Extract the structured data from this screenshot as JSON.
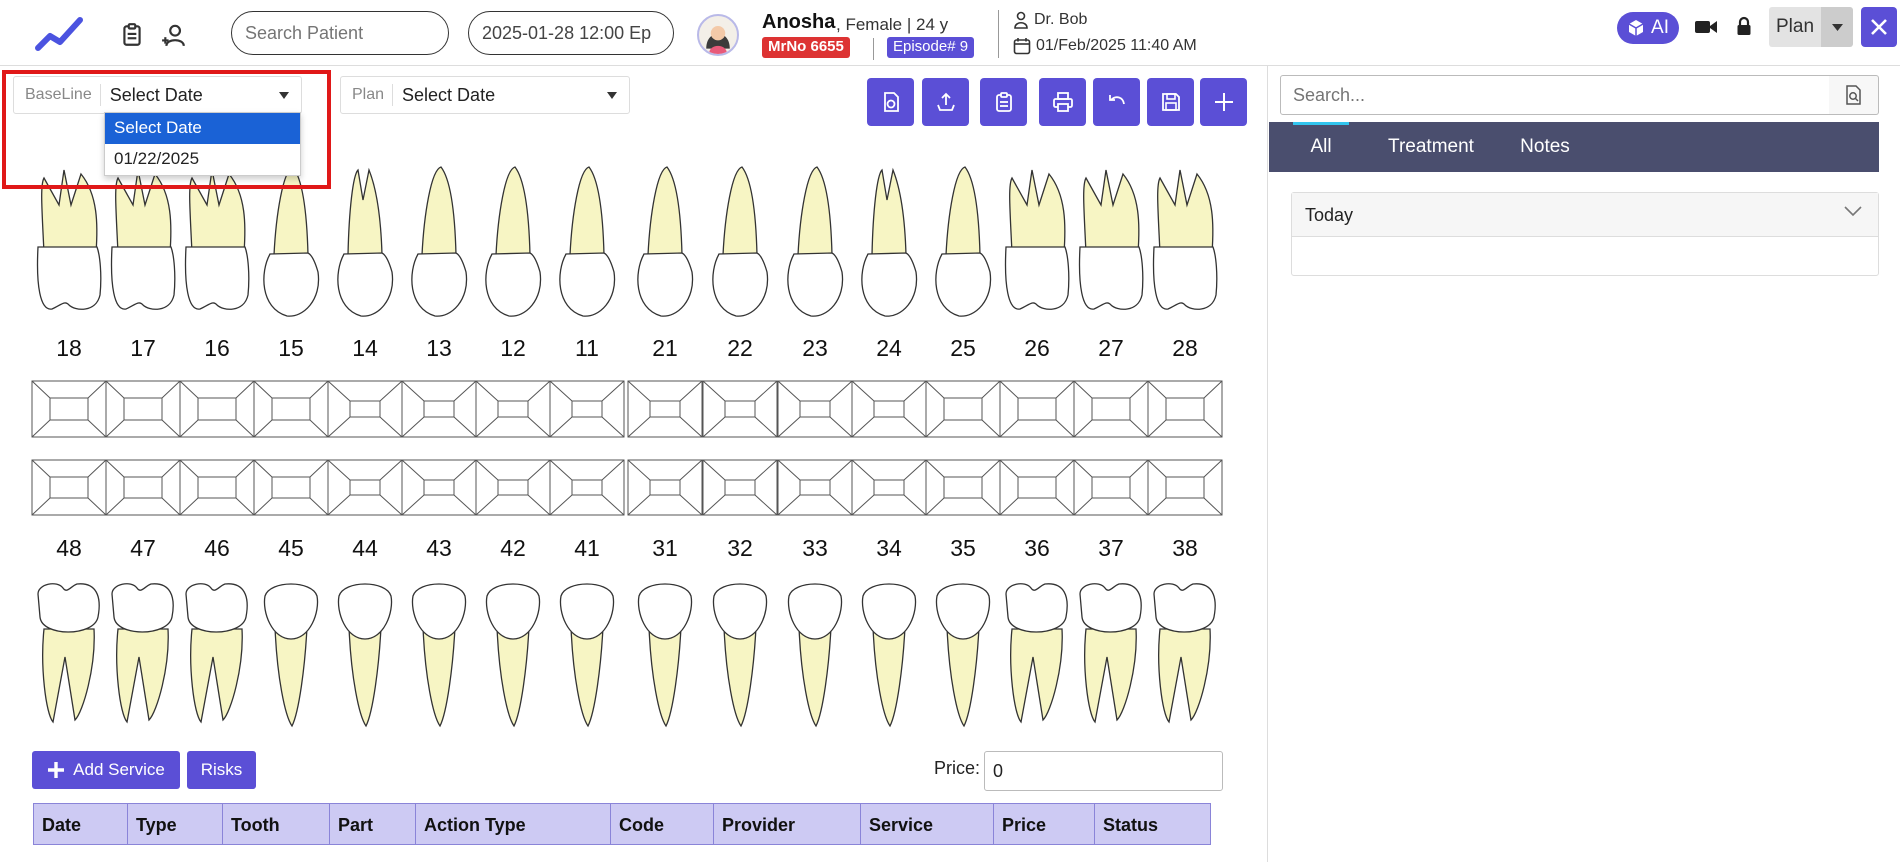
{
  "header": {
    "search_placeholder": "Search Patient",
    "datetime_value": "2025-01-28 12:00 Ep",
    "patient_name": "Anosha",
    "patient_info": ", Female | 24 y",
    "mrno": "MrNo 6655",
    "episode": "Episode# 9",
    "doctor": "Dr. Bob",
    "visit_datetime": "01/Feb/2025 11:40 AM",
    "ai_label": "AI",
    "plan_label": "Plan"
  },
  "filters": {
    "baseline_label": "BaseLine",
    "baseline_value": "Select Date",
    "plan_label": "Plan",
    "plan_value": "Select Date",
    "dropdown_options": [
      "Select Date",
      "01/22/2025"
    ],
    "dropdown_selected": "Select Date"
  },
  "toolbar_icons": [
    "view-icon",
    "upload-icon",
    "clipboard-icon",
    "print-icon",
    "undo-icon",
    "save-icon",
    "add-icon"
  ],
  "upper_teeth": [
    "18",
    "17",
    "16",
    "15",
    "14",
    "13",
    "12",
    "11",
    "21",
    "22",
    "23",
    "24",
    "25",
    "26",
    "27",
    "28"
  ],
  "lower_teeth": [
    "48",
    "47",
    "46",
    "45",
    "44",
    "43",
    "42",
    "41",
    "31",
    "32",
    "33",
    "34",
    "35",
    "36",
    "37",
    "38"
  ],
  "actions": {
    "add_service": "Add Service",
    "risks": "Risks",
    "price_label": "Price:",
    "price_value": "0"
  },
  "service_table": {
    "columns": [
      "Date",
      "Type",
      "Tooth",
      "Part",
      "Action Type",
      "Code",
      "Provider",
      "Service",
      "Price",
      "Status"
    ]
  },
  "right_panel": {
    "search_placeholder": "Search...",
    "tabs": [
      "All",
      "Treatment",
      "Notes"
    ],
    "active_tab": "All",
    "accordion_title": "Today"
  },
  "colors": {
    "accent": "#5b4fd6",
    "tabbar": "#4a4e6e",
    "mrno_badge": "#dd3333",
    "tooth_root": "#f7f5c4",
    "table_header": "#cdcaf3",
    "highlight": "#e01818"
  }
}
